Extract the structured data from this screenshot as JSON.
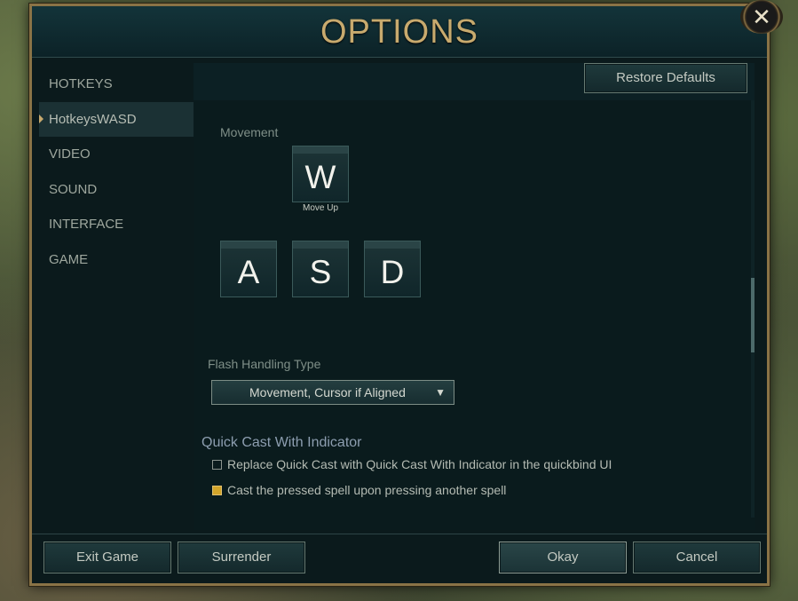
{
  "window": {
    "title": "OPTIONS",
    "close_glyph": "✕"
  },
  "sidebar": {
    "items": [
      {
        "label": "HOTKEYS",
        "active": false
      },
      {
        "label": "HotkeysWASD",
        "active": true
      },
      {
        "label": "VIDEO",
        "active": false
      },
      {
        "label": "SOUND",
        "active": false
      },
      {
        "label": "INTERFACE",
        "active": false
      },
      {
        "label": "GAME",
        "active": false
      }
    ]
  },
  "toolbar": {
    "restore_label": "Restore Defaults"
  },
  "movement": {
    "label": "Movement",
    "keys": {
      "up": {
        "key": "W",
        "caption": "Move Up"
      },
      "left": {
        "key": "A"
      },
      "down": {
        "key": "S"
      },
      "right": {
        "key": "D"
      }
    }
  },
  "flash": {
    "label": "Flash Handling Type",
    "selected": "Movement, Cursor if Aligned",
    "arrow_glyph": "▼"
  },
  "quick_cast": {
    "heading": "Quick Cast With Indicator",
    "options": [
      {
        "label": "Replace Quick Cast with Quick Cast With Indicator in the quickbind UI",
        "checked": false
      },
      {
        "label": "Cast the pressed spell upon pressing another spell",
        "checked": true
      }
    ]
  },
  "footer": {
    "exit_label": "Exit Game",
    "surrender_label": "Surrender",
    "okay_label": "Okay",
    "cancel_label": "Cancel"
  },
  "colors": {
    "gold_accent": "#c8aa6e",
    "checkbox_checked": "#d3a52a",
    "panel_bg": "#0b1a1c"
  }
}
